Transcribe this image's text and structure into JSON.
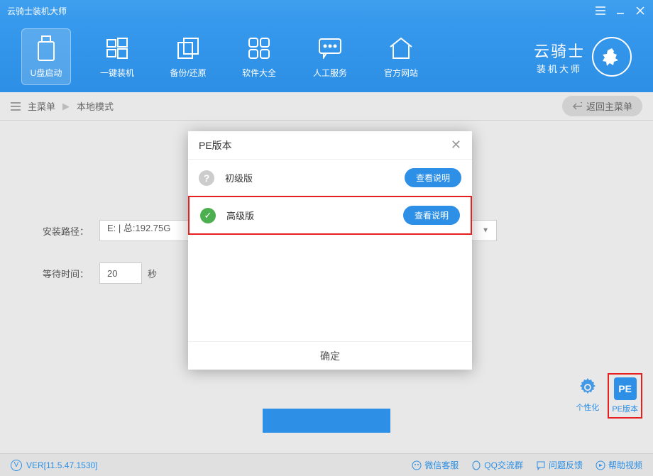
{
  "titlebar": {
    "title": "云骑士装机大师"
  },
  "nav": {
    "items": [
      {
        "label": "U盘启动",
        "icon": "usb"
      },
      {
        "label": "一键装机",
        "icon": "windows"
      },
      {
        "label": "备份/还原",
        "icon": "backup"
      },
      {
        "label": "软件大全",
        "icon": "apps"
      },
      {
        "label": "人工服务",
        "icon": "chat"
      },
      {
        "label": "官方网站",
        "icon": "home"
      }
    ]
  },
  "brand": {
    "main": "云骑士",
    "sub": "装机大师"
  },
  "breadcrumb": {
    "main_menu": "主菜单",
    "current": "本地模式",
    "back": "返回主菜单"
  },
  "form": {
    "path_label": "安装路径：",
    "path_value": "E: | 总:192.75G",
    "time_label": "等待时间：",
    "time_value": "20",
    "time_unit": "秒"
  },
  "side_tools": {
    "personalize": "个性化",
    "pe_version": "PE版本"
  },
  "footer": {
    "version": "VER[11.5.47.1530]",
    "links": {
      "wechat": "微信客服",
      "qq": "QQ交流群",
      "feedback": "问题反馈",
      "help": "帮助视频"
    }
  },
  "modal": {
    "title": "PE版本",
    "options": [
      {
        "label": "初级版",
        "selected": false,
        "view": "查看说明"
      },
      {
        "label": "高级版",
        "selected": true,
        "view": "查看说明"
      }
    ],
    "confirm": "确定"
  }
}
